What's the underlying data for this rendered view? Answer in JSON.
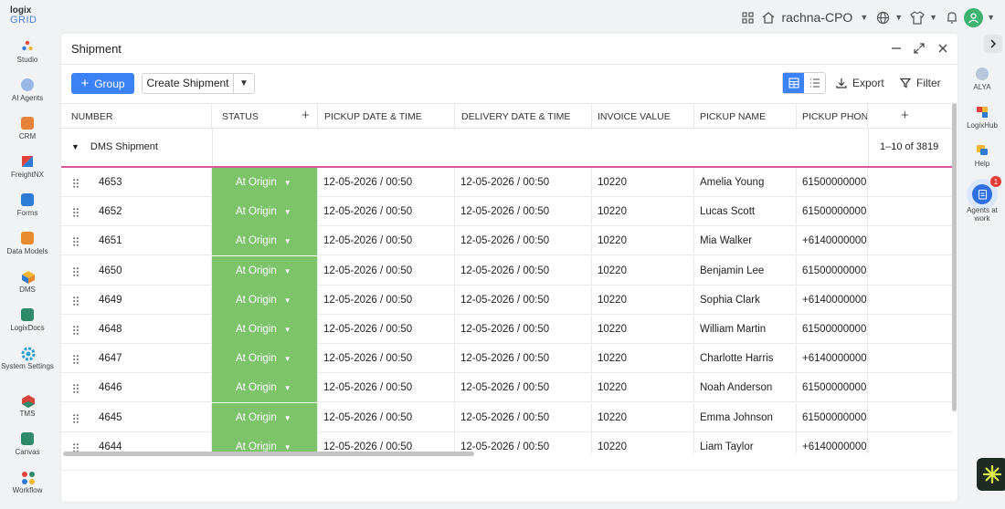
{
  "app": {
    "logo_line1": "logix",
    "logo_line2": "GRID",
    "user_name": "rachna-CPO"
  },
  "left_nav": [
    {
      "label": "Studio",
      "icon": "studio-icon",
      "color": "#e64a3b"
    },
    {
      "label": "AI Agents",
      "icon": "ai-agents-icon",
      "color": "#9bb7e8"
    },
    {
      "label": "CRM",
      "icon": "crm-icon",
      "color": "#e8833a"
    },
    {
      "label": "FreightNX",
      "icon": "freightnx-icon",
      "color": "#e0433b"
    },
    {
      "label": "Forms",
      "icon": "forms-icon",
      "color": "#2e7bd6"
    },
    {
      "label": "Data Models",
      "icon": "data-models-icon",
      "color": "#e88a2e"
    },
    {
      "label": "DMS",
      "icon": "dms-icon",
      "color": "#f2b632"
    },
    {
      "label": "LogixDocs",
      "icon": "logixdocs-icon",
      "color": "#2f8a6a"
    },
    {
      "label": "System Settings",
      "icon": "settings-icon",
      "color": "#2e9fd6"
    },
    {
      "label": "TMS",
      "icon": "tms-icon",
      "color": "#d6453b"
    },
    {
      "label": "Canvas",
      "icon": "canvas-icon",
      "color": "#2f8a6a"
    },
    {
      "label": "Workflow",
      "icon": "workflow-icon",
      "color": "#e0433b"
    }
  ],
  "right_nav": [
    {
      "label": "ALYA",
      "icon": "alya-icon",
      "color": "#b7c7d9"
    },
    {
      "label": "LogixHub",
      "icon": "logixhub-icon",
      "color": "#e0433b"
    },
    {
      "label": "Help",
      "icon": "help-icon",
      "color": "#f2b632"
    }
  ],
  "agents_at_work": {
    "label": "Agents at work",
    "badge": "1"
  },
  "panel": {
    "title": "Shipment",
    "group_button": "Group",
    "create_button": "Create Shipment",
    "export_label": "Export",
    "filter_label": "Filter"
  },
  "table": {
    "columns": [
      "NUMBER",
      "STATUS",
      "PICKUP DATE & TIME",
      "DELIVERY DATE & TIME",
      "INVOICE VALUE",
      "PICKUP NAME",
      "PICKUP PHONE"
    ],
    "group_label": "DMS Shipment",
    "pager_text": "1–10 of 3819",
    "rows": [
      {
        "number": "4653",
        "status": "At Origin",
        "pickup": "12-05-2026 / 00:50",
        "delivery": "12-05-2026 / 00:50",
        "invoice": "10220",
        "name": "Amelia Young",
        "phone": "61500000000"
      },
      {
        "number": "4652",
        "status": "At Origin",
        "pickup": "12-05-2026 / 00:50",
        "delivery": "12-05-2026 / 00:50",
        "invoice": "10220",
        "name": "Lucas Scott",
        "phone": "61500000000"
      },
      {
        "number": "4651",
        "status": "At Origin",
        "pickup": "12-05-2026 / 00:50",
        "delivery": "12-05-2026 / 00:50",
        "invoice": "10220",
        "name": "Mia Walker",
        "phone": "+614000000000"
      },
      {
        "number": "4650",
        "status": "At Origin",
        "pickup": "12-05-2026 / 00:50",
        "delivery": "12-05-2026 / 00:50",
        "invoice": "10220",
        "name": "Benjamin Lee",
        "phone": "61500000000"
      },
      {
        "number": "4649",
        "status": "At Origin",
        "pickup": "12-05-2026 / 00:50",
        "delivery": "12-05-2026 / 00:50",
        "invoice": "10220",
        "name": "Sophia Clark",
        "phone": "+614000000000"
      },
      {
        "number": "4648",
        "status": "At Origin",
        "pickup": "12-05-2026 / 00:50",
        "delivery": "12-05-2026 / 00:50",
        "invoice": "10220",
        "name": "William Martin",
        "phone": "61500000000"
      },
      {
        "number": "4647",
        "status": "At Origin",
        "pickup": "12-05-2026 / 00:50",
        "delivery": "12-05-2026 / 00:50",
        "invoice": "10220",
        "name": "Charlotte Harris",
        "phone": "+614000000000"
      },
      {
        "number": "4646",
        "status": "At Origin",
        "pickup": "12-05-2026 / 00:50",
        "delivery": "12-05-2026 / 00:50",
        "invoice": "10220",
        "name": "Noah Anderson",
        "phone": "61500000000"
      },
      {
        "number": "4645",
        "status": "At Origin",
        "pickup": "12-05-2026 / 00:50",
        "delivery": "12-05-2026 / 00:50",
        "invoice": "10220",
        "name": "Emma Johnson",
        "phone": "61500000000"
      },
      {
        "number": "4644",
        "status": "At Origin",
        "pickup": "12-05-2026 / 00:50",
        "delivery": "12-05-2026 / 00:50",
        "invoice": "10220",
        "name": "Liam Taylor",
        "phone": "+614000000000"
      }
    ]
  },
  "colors": {
    "accent": "#3b82f6",
    "status_green": "#7dc36a",
    "group_underline": "#d9559c"
  }
}
